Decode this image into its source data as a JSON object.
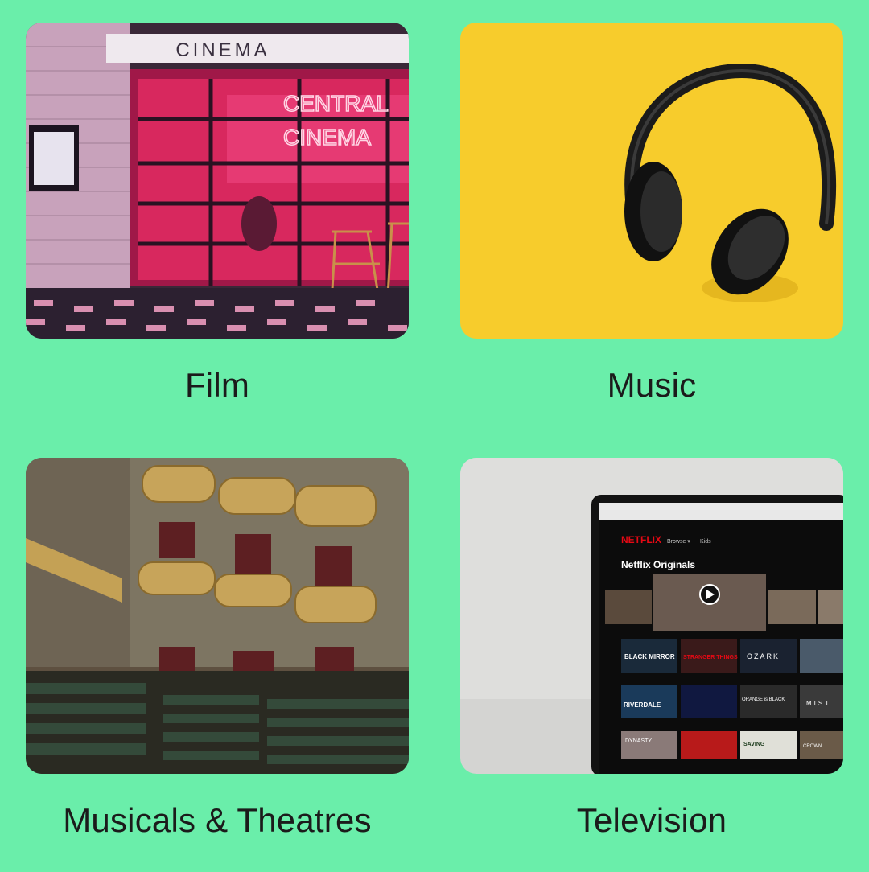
{
  "categories": [
    {
      "id": "film",
      "label": "Film",
      "image": "cinema-storefront-photo"
    },
    {
      "id": "music",
      "label": "Music",
      "image": "headphones-photo"
    },
    {
      "id": "theatre",
      "label": "Musicals & Theatres",
      "image": "theatre-auditorium-photo"
    },
    {
      "id": "tv",
      "label": "Television",
      "image": "netflix-laptop-photo"
    }
  ],
  "film_image": {
    "sign": "CINEMA",
    "neon_line1": "CENTRAL",
    "neon_line2": "CINEMA"
  },
  "tv_image": {
    "brand": "NETFLIX",
    "nav_browse": "Browse ▾",
    "nav_kids": "Kids",
    "row_title": "Netflix Originals",
    "posters": [
      "BLACK MIRROR",
      "STRANGER THINGS",
      "OZARK",
      "RIVERDALE",
      "ORANGE is BLACK",
      "MIST",
      "DYNASTY",
      "SAVING",
      "CROWN"
    ]
  },
  "colors": {
    "background": "#6aeeaa",
    "label_text": "#1b1b1b"
  }
}
